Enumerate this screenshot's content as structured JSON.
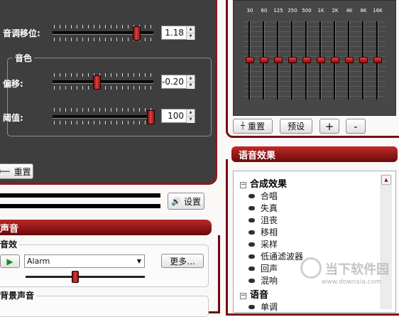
{
  "pitch_panel": {
    "pitch_shift_label": "音调移位:",
    "pitch_shift_value": "1.18",
    "pitch_shift_slider_fraction": 0.85,
    "timbre_title": "音色",
    "offset_label": "偏移:",
    "offset_value": "-0.20",
    "offset_slider_fraction": 0.42,
    "threshold_label": "阈值:",
    "threshold_value": "100",
    "threshold_slider_fraction": 1.0,
    "reset_label": "重置"
  },
  "output": {
    "settings_label": "设置"
  },
  "sound": {
    "header": "声音",
    "effects_title": "音效",
    "selected_effect": "Alarm",
    "more_label": "更多...",
    "volume_slider_fraction": 0.43,
    "background_title": "背景声音"
  },
  "equalizer": {
    "bands": [
      "30",
      "60",
      "125",
      "250",
      "500",
      "1K",
      "2K",
      "4K",
      "8K",
      "16K"
    ],
    "reset_label": "重置",
    "preset_label": "预设",
    "plus_label": "+",
    "minus_label": "-"
  },
  "voice_effects": {
    "header": "语音效果",
    "groups": [
      {
        "label": "合成效果",
        "items": [
          "合唱",
          "失真",
          "沮丧",
          "移相",
          "采样",
          "低通滤波器",
          "回声",
          "混响"
        ]
      },
      {
        "label": "语音",
        "items": [
          "单调"
        ]
      }
    ]
  },
  "watermark": {
    "text": "当下软件园",
    "url": "www.downxia.com"
  },
  "colors": {
    "accent": "#8d1a1a",
    "panel_dark": "#3e3e3e",
    "knob_red": "#c02a2a"
  }
}
